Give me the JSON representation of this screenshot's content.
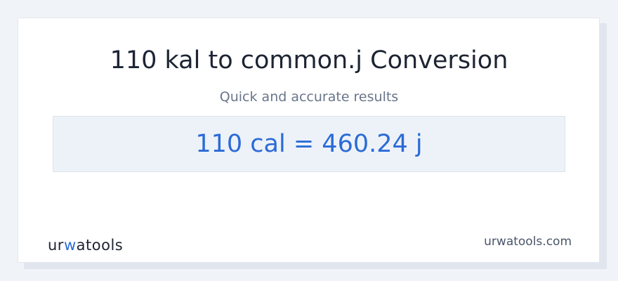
{
  "header": {
    "title": "110 kal to common.j Conversion",
    "subtitle": "Quick and accurate results"
  },
  "result": {
    "text": "110 cal = 460.24 j"
  },
  "footer": {
    "logo_prefix": "ur",
    "logo_accent": "w",
    "logo_suffix": "atools",
    "site": "urwatools.com"
  },
  "colors": {
    "accent": "#2b6bd6",
    "text": "#1d2433",
    "muted": "#69758a",
    "result_bg": "#edf2f8"
  }
}
